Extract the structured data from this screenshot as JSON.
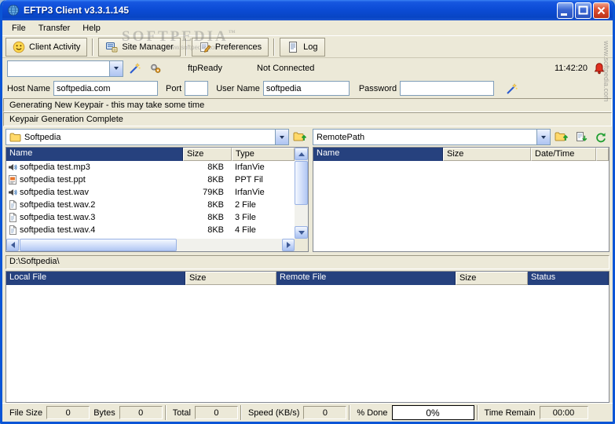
{
  "window": {
    "title": "EFTP3 Client v3.3.1.145"
  },
  "menu": {
    "items": [
      "File",
      "Transfer",
      "Help"
    ]
  },
  "toolbar": {
    "buttons": [
      "Client Activity",
      "Site Manager",
      "Preferences",
      "Log"
    ]
  },
  "status_row": {
    "quick_connect_value": "",
    "state": "ftpReady",
    "connection": "Not Connected",
    "time": "11:42:20"
  },
  "connection": {
    "host_label": "Host Name",
    "host_value": "softpedia.com",
    "port_label": "Port",
    "port_value": "",
    "user_label": "User Name",
    "user_value": "softpedia",
    "password_label": "Password",
    "password_value": ""
  },
  "messages": {
    "line1": "Generating New Keypair - this may take some time",
    "line2": "Keypair Generation Complete"
  },
  "local_pane": {
    "path_selector": "Softpedia",
    "columns": [
      "Name",
      "Size",
      "Type"
    ],
    "files": [
      {
        "icon": "sound",
        "name": "softpedia test.mp3",
        "size": "8KB",
        "type": "IrfanVie"
      },
      {
        "icon": "ppt",
        "name": "softpedia test.ppt",
        "size": "8KB",
        "type": "PPT Fil"
      },
      {
        "icon": "sound",
        "name": "softpedia test.wav",
        "size": "79KB",
        "type": "IrfanVie"
      },
      {
        "icon": "generic",
        "name": "softpedia test.wav.2",
        "size": "8KB",
        "type": "2 File"
      },
      {
        "icon": "generic",
        "name": "softpedia test.wav.3",
        "size": "8KB",
        "type": "3 File"
      },
      {
        "icon": "generic",
        "name": "softpedia test.wav.4",
        "size": "8KB",
        "type": "4 File"
      }
    ],
    "current_path": "D:\\Softpedia\\"
  },
  "remote_pane": {
    "path_selector": "RemotePath",
    "columns": [
      "Name",
      "Size",
      "Date/Time"
    ]
  },
  "transfer_pane": {
    "columns": [
      "Local File",
      "Size",
      "Remote File",
      "Size",
      "Status"
    ]
  },
  "status_bar": {
    "file_size_label": "File Size",
    "file_size_value": "0",
    "bytes_label": "Bytes",
    "bytes_value": "0",
    "total_label": "Total",
    "total_value": "0",
    "speed_label": "Speed (KB/s)",
    "speed_value": "0",
    "done_label": "% Done",
    "progress_text": "0%",
    "time_label": "Time Remain",
    "time_value": "00:00"
  },
  "watermark": {
    "brand": "SOFTPEDIA",
    "tm": "™",
    "url": "www.softpedia.com"
  },
  "colors": {
    "titlebar_blue": "#0a4cd6",
    "header_navy": "#26417e",
    "window_bg": "#ece9d8",
    "alert_red": "#e03020"
  },
  "icons": {
    "toolbar": [
      "smiley-icon",
      "site-manager-icon",
      "preferences-icon",
      "log-icon"
    ],
    "status_row": [
      "wand-icon",
      "gears-icon",
      "alarm-bell-icon"
    ],
    "pane_buttons": [
      "folder-up-icon",
      "page-refresh-icon",
      "refresh-icon"
    ],
    "file_icons": [
      "sound-file-icon",
      "ppt-file-icon",
      "generic-file-icon"
    ]
  }
}
